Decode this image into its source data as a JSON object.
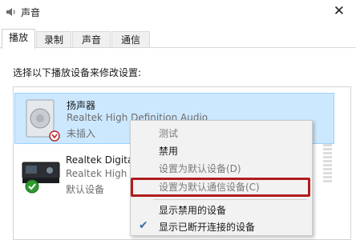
{
  "window": {
    "title": "声音",
    "close_glyph": "✕"
  },
  "tabs": [
    {
      "label": "播放",
      "active": true
    },
    {
      "label": "录制",
      "active": false
    },
    {
      "label": "声音",
      "active": false
    },
    {
      "label": "通信",
      "active": false
    }
  ],
  "playback": {
    "instruction": "选择以下播放设备来修改设置:",
    "devices": [
      {
        "name": "扬声器",
        "driver": "Realtek High Definition Audio",
        "state": "未插入",
        "selected": true,
        "icon": "speaker-icon",
        "status_icon": "unplugged-icon"
      },
      {
        "name": "Realtek Digital",
        "driver": "Realtek High D",
        "state": "默认设备",
        "selected": false,
        "icon": "digital-output-icon",
        "status_icon": "default-check-icon"
      }
    ]
  },
  "context_menu": {
    "items": [
      {
        "label": "测试",
        "disabled": true,
        "checked": false
      },
      {
        "label": "禁用",
        "disabled": false,
        "checked": false
      },
      {
        "label": "设置为默认设备(D)",
        "disabled": true,
        "checked": false
      },
      {
        "label": "设置为默认通信设备(C)",
        "disabled": true,
        "checked": false,
        "highlighted": true
      },
      {
        "label": "显示禁用的设备",
        "disabled": false,
        "checked": false
      },
      {
        "label": "显示已断开连接的设备",
        "disabled": false,
        "checked": true
      }
    ]
  },
  "colors": {
    "selection_fill": "#cce8ff",
    "selection_border": "#99d1ff",
    "highlight_frame": "#b01c1c",
    "check_blue": "#3a6ea5"
  }
}
